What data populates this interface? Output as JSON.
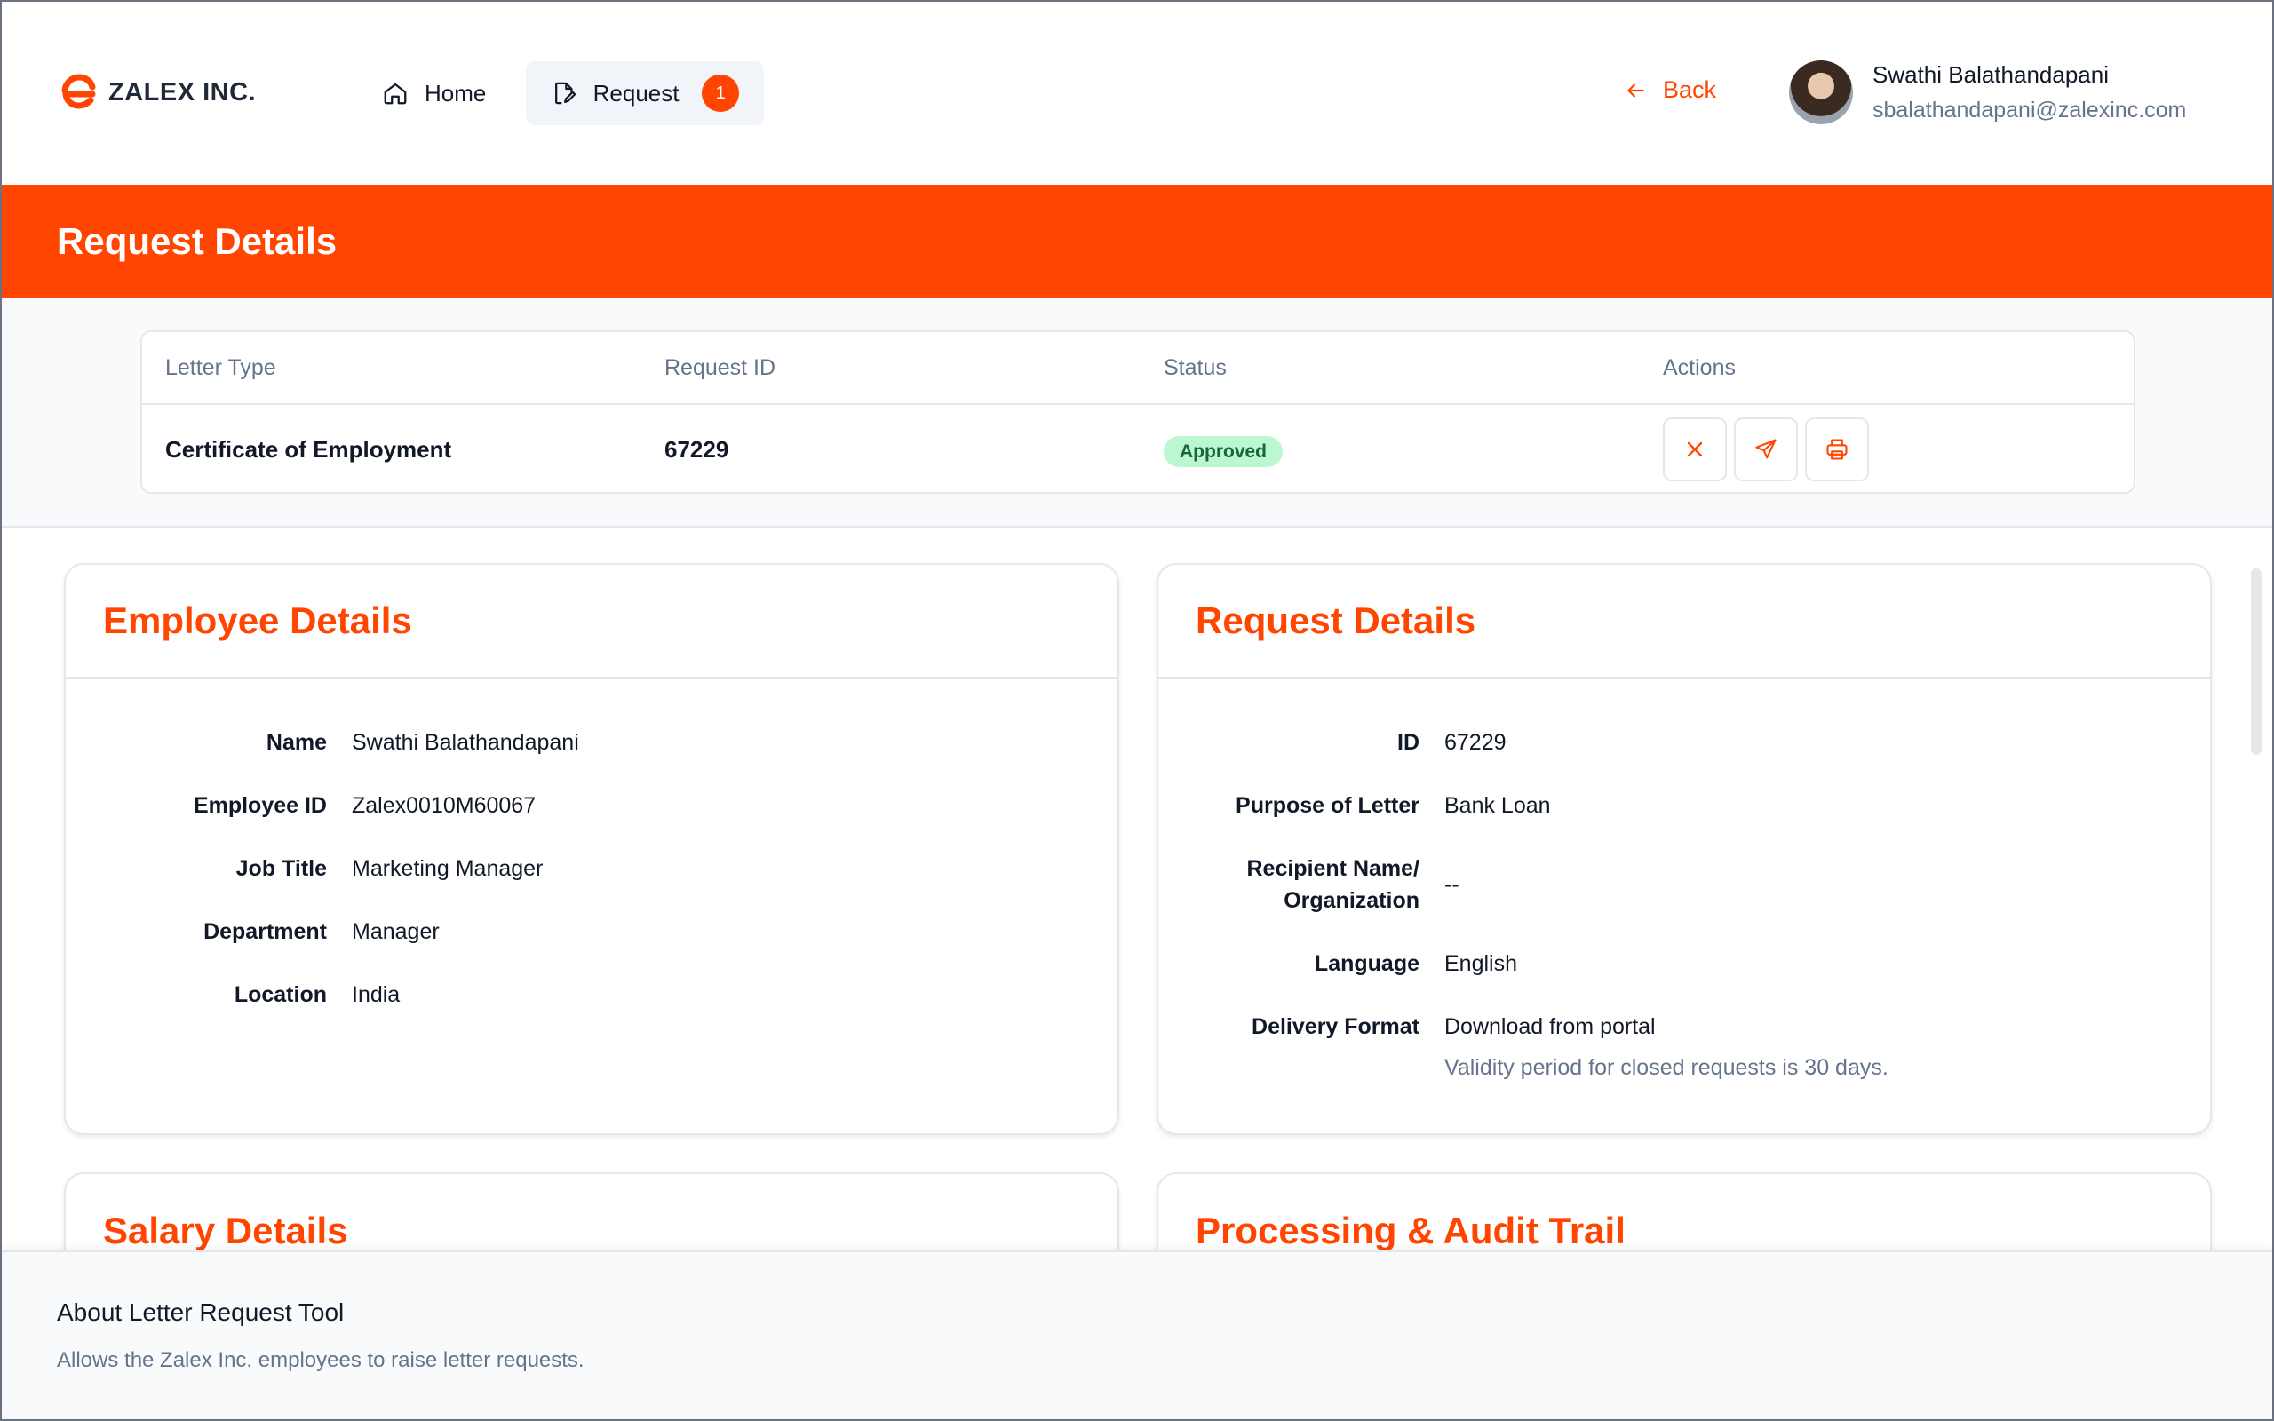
{
  "brand": {
    "name": "ZALEX INC.",
    "accent_color": "#ff4500"
  },
  "nav": {
    "home_label": "Home",
    "request_label": "Request",
    "request_badge": "1"
  },
  "back_label": "Back",
  "user": {
    "name": "Swathi Balathandapani",
    "email": "sbalathandapani@zalexinc.com"
  },
  "banner_title": "Request Details",
  "summary": {
    "headers": {
      "letter_type": "Letter Type",
      "request_id": "Request ID",
      "status": "Status",
      "actions": "Actions"
    },
    "row": {
      "letter_type": "Certificate of Employment",
      "request_id": "67229",
      "status": "Approved"
    },
    "action_icons": [
      "close-icon",
      "send-icon",
      "print-icon"
    ]
  },
  "employee_details": {
    "title": "Employee Details",
    "fields": [
      {
        "label": "Name",
        "value": "Swathi Balathandapani"
      },
      {
        "label": "Employee ID",
        "value": "Zalex0010M60067"
      },
      {
        "label": "Job Title",
        "value": "Marketing Manager"
      },
      {
        "label": "Department",
        "value": "Manager"
      },
      {
        "label": "Location",
        "value": "India"
      }
    ]
  },
  "request_details": {
    "title": "Request Details",
    "id_label": "ID",
    "id_value": "67229",
    "purpose_label": "Purpose of Letter",
    "purpose_value": "Bank Loan",
    "recipient_label_line1": "Recipient Name/",
    "recipient_label_line2": "Organization",
    "recipient_value": "--",
    "language_label": "Language",
    "language_value": "English",
    "delivery_label": "Delivery Format",
    "delivery_value": "Download from portal",
    "delivery_note": "Validity period for closed requests is 30 days."
  },
  "salary_details_title": "Salary Details",
  "processing_title": "Processing & Audit Trail",
  "footer": {
    "title": "About Letter Request Tool",
    "description": "Allows the Zalex Inc. employees to raise letter requests."
  }
}
